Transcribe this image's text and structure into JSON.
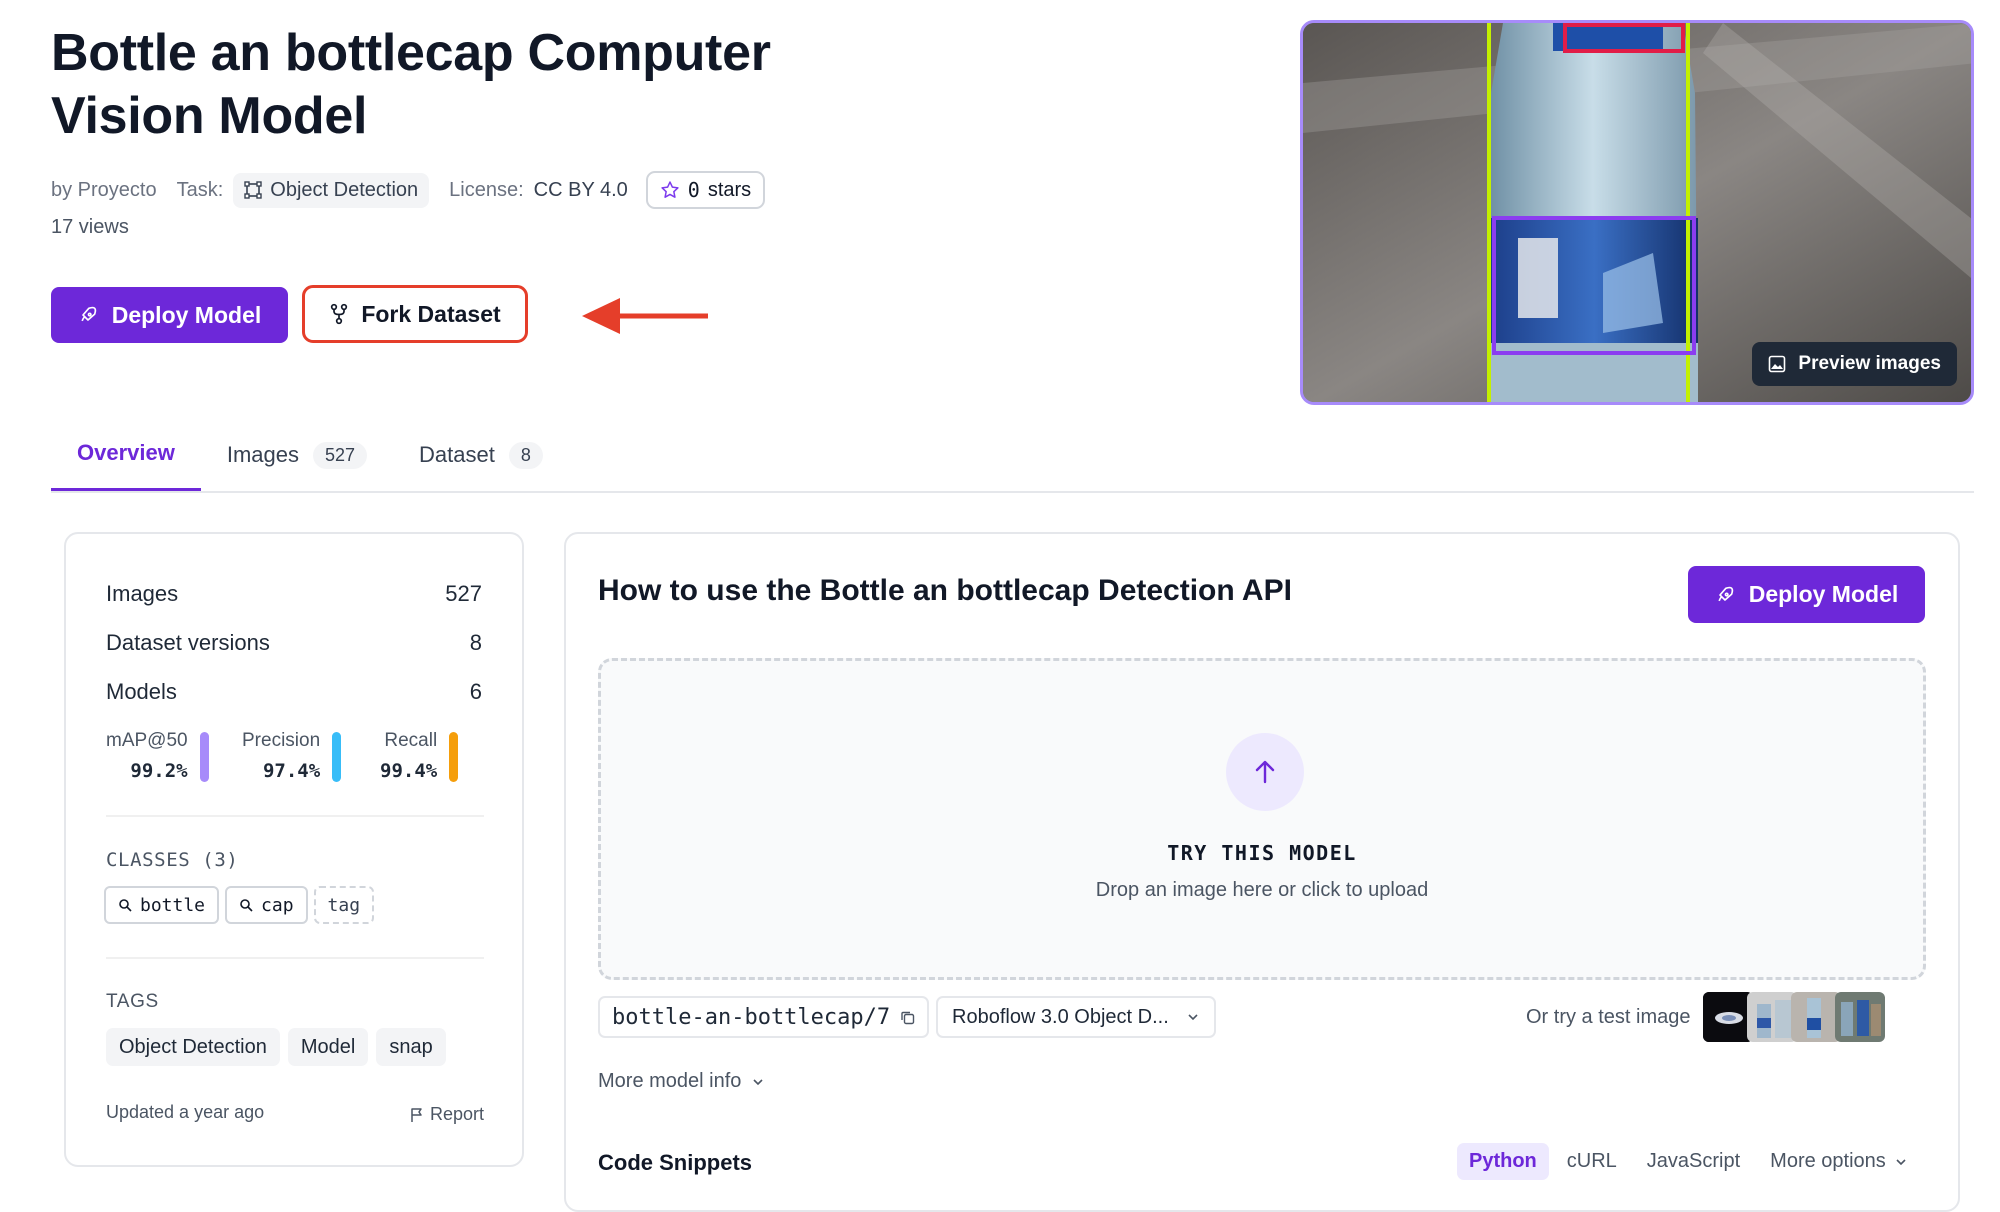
{
  "header": {
    "title": "Bottle an bottlecap Computer Vision Model",
    "by": "by Proyecto",
    "task_label": "Task:",
    "task_value": "Object Detection",
    "license_label": "License:",
    "license_value": "CC BY 4.0",
    "stars_count": "0",
    "stars_label": "stars",
    "views": "17 views",
    "deploy_label": "Deploy Model",
    "fork_label": "Fork Dataset",
    "preview_label": "Preview images"
  },
  "tabs": [
    {
      "label": "Overview",
      "count": ""
    },
    {
      "label": "Images",
      "count": "527"
    },
    {
      "label": "Dataset",
      "count": "8"
    }
  ],
  "stats": {
    "rows": [
      {
        "label": "Images",
        "value": "527"
      },
      {
        "label": "Dataset versions",
        "value": "8"
      },
      {
        "label": "Models",
        "value": "6"
      }
    ],
    "metrics": [
      {
        "label": "mAP@50",
        "value": "99.2%",
        "color": "#a78bfa"
      },
      {
        "label": "Precision",
        "value": "97.4%",
        "color": "#38bdf8"
      },
      {
        "label": "Recall",
        "value": "99.4%",
        "color": "#f59e0b"
      }
    ],
    "classes_label": "CLASSES (3)",
    "classes": [
      "bottle",
      "cap",
      "tag"
    ],
    "tags_label": "TAGS",
    "tags": [
      "Object Detection",
      "Model",
      "snap"
    ],
    "updated": "Updated a year ago",
    "report_label": "Report"
  },
  "api": {
    "title": "How to use the Bottle an bottlecap Detection API",
    "deploy_label": "Deploy Model",
    "try_label": "TRY THIS MODEL",
    "drop_text": "Drop an image here or click to upload",
    "model_id": "bottle-an-bottlecap/7",
    "model_select": "Roboflow 3.0 Object D...",
    "test_label": "Or try a test image",
    "more_info": "More model info",
    "code_title": "Code Snippets",
    "code_tabs": [
      "Python",
      "cURL",
      "JavaScript",
      "More options"
    ]
  },
  "colors": {
    "accent": "#6d28d9",
    "fork_highlight": "#e53e2a",
    "arrow": "#e53e2a"
  }
}
